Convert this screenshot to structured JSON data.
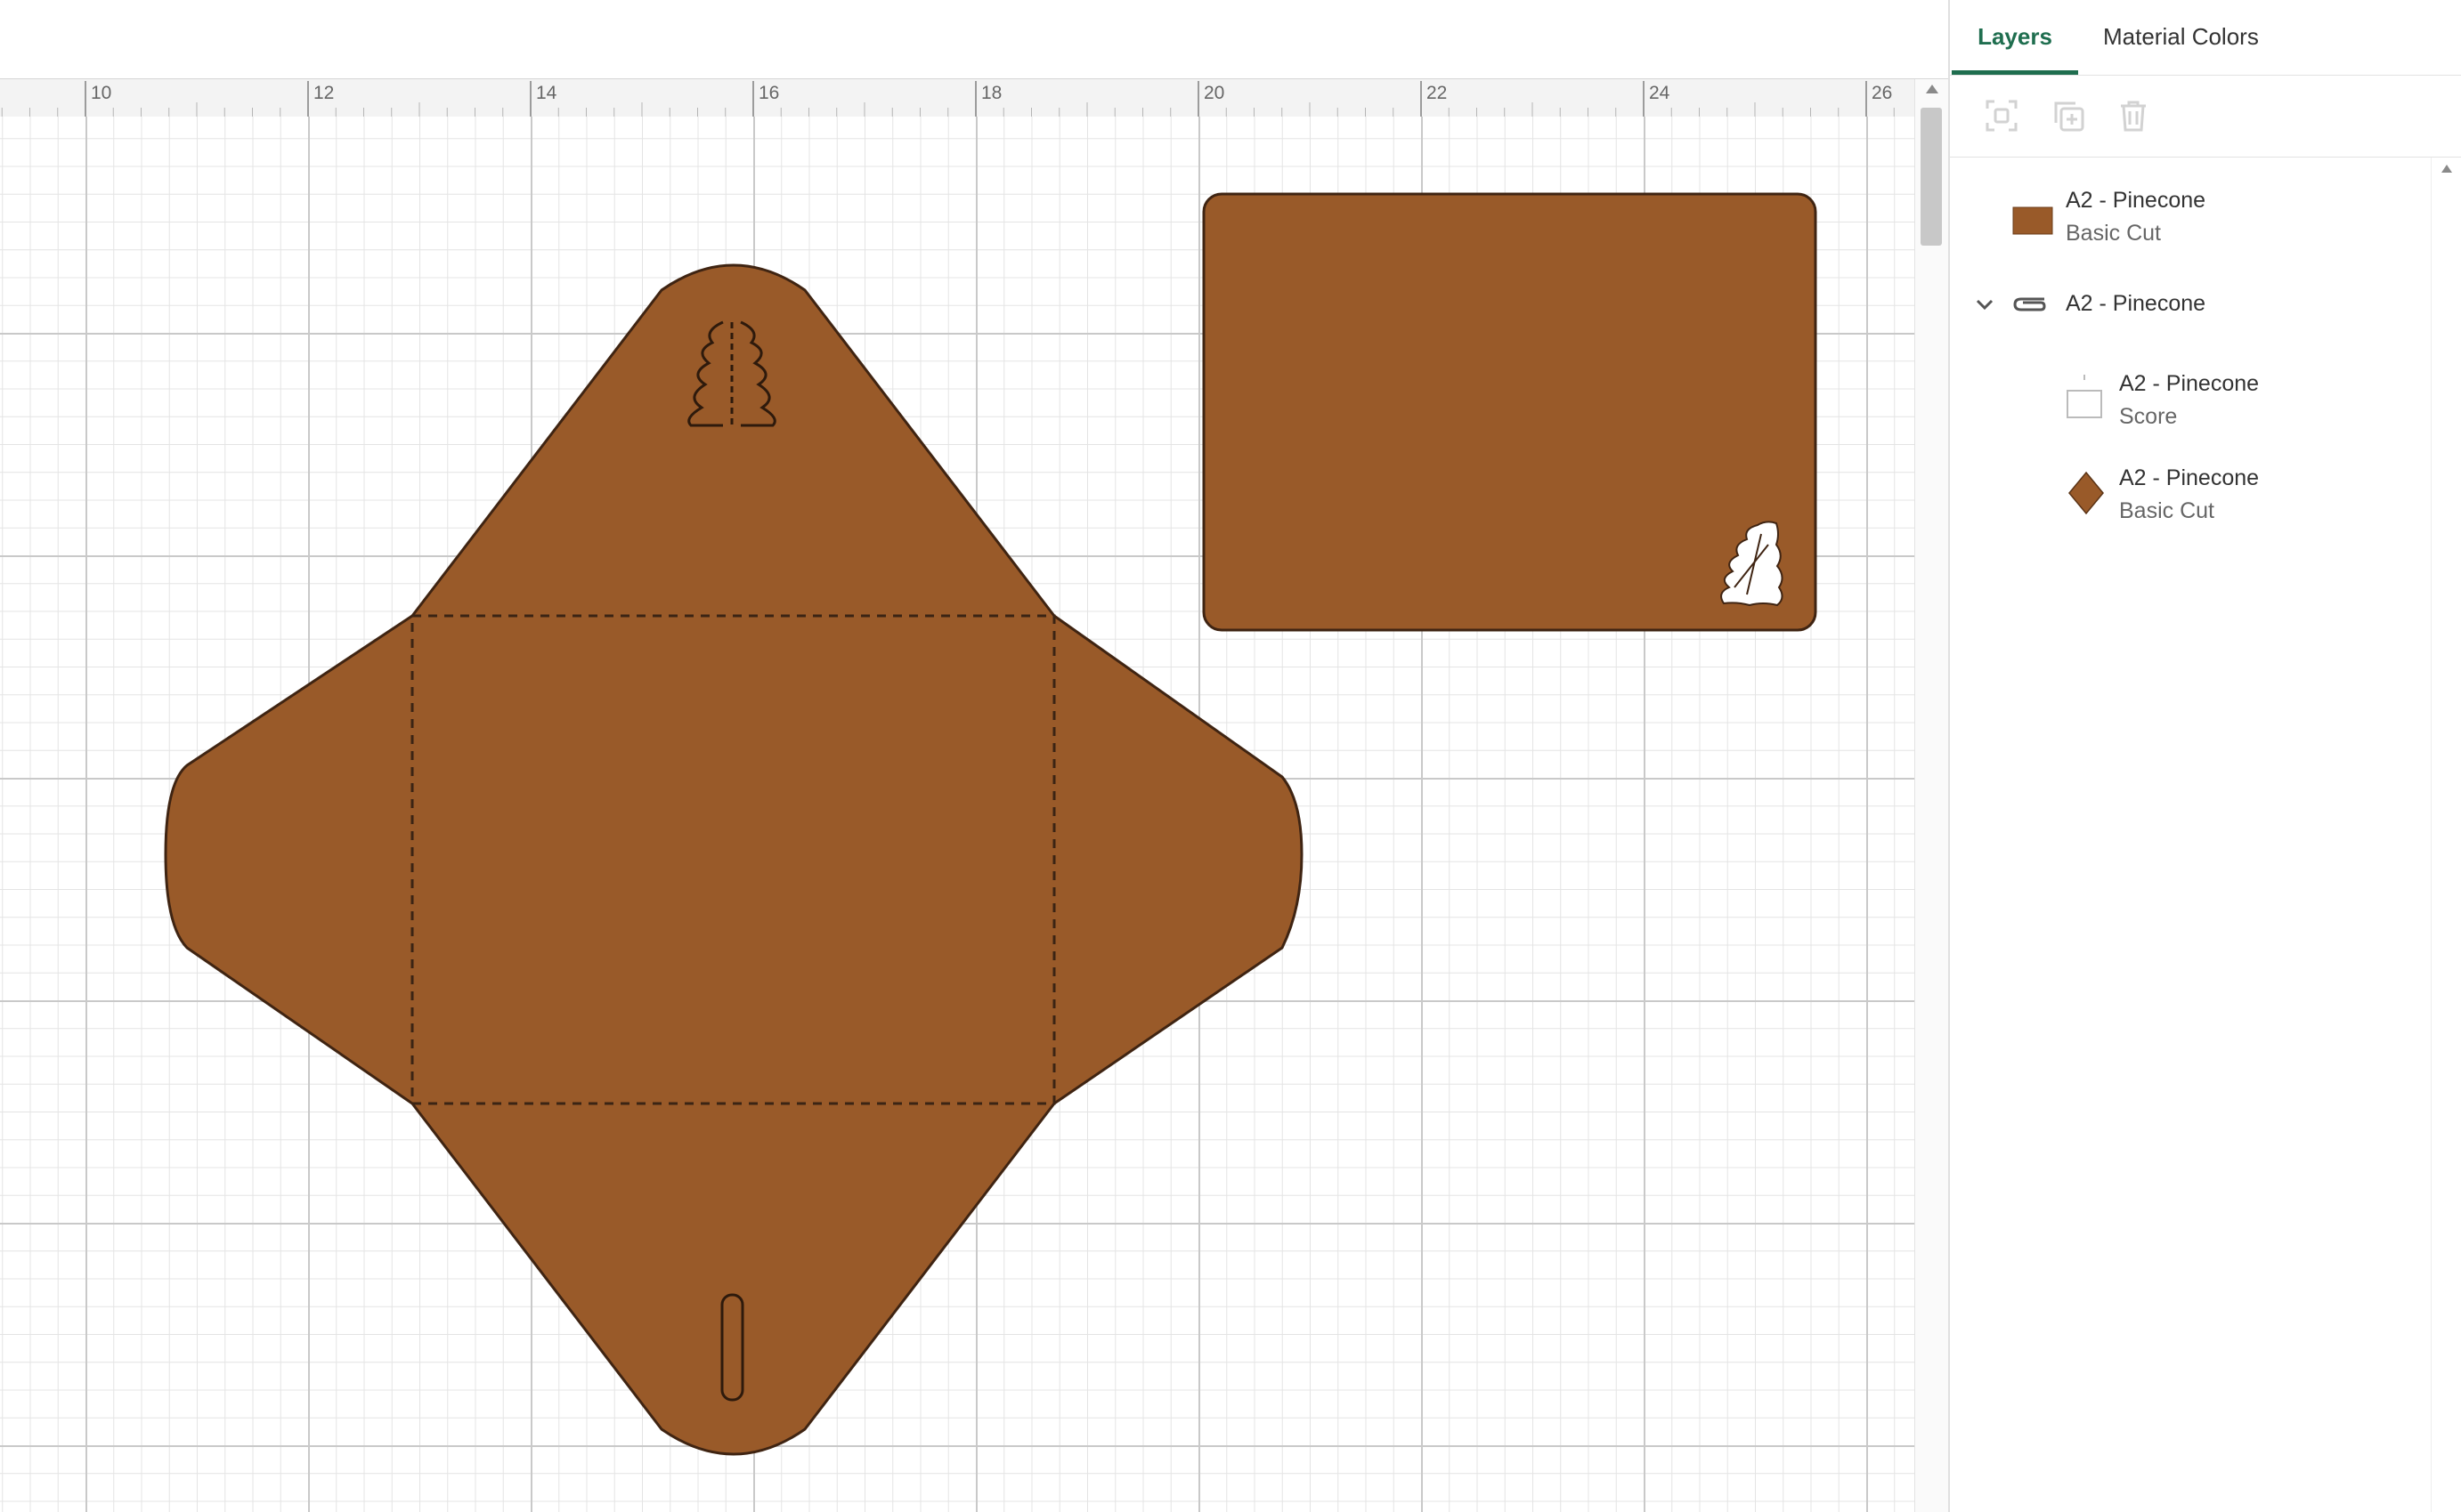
{
  "ruler": {
    "labels": [
      "10",
      "12",
      "14",
      "16",
      "18",
      "20",
      "22",
      "24",
      "26"
    ]
  },
  "colors": {
    "material": "#995a29",
    "outline": "#3f2412",
    "accent": "#1f6e4f",
    "grid_major": "#c9c9c9",
    "grid_minor": "#e4e4e4"
  },
  "panel": {
    "tabs": [
      {
        "label": "Layers",
        "active": true
      },
      {
        "label": "Material Colors",
        "active": false
      }
    ],
    "toolbar": [
      {
        "icon": "group-icon",
        "enabled": false
      },
      {
        "icon": "duplicate-icon",
        "enabled": false
      },
      {
        "icon": "trash-icon",
        "enabled": false
      }
    ],
    "layers": [
      {
        "name": "A2 - Pinecone",
        "operation": "Basic Cut",
        "thumb": "rectangle-swatch"
      },
      {
        "name": "A2 - Pinecone",
        "group": true,
        "expanded": true,
        "icon": "attach-icon"
      },
      {
        "name": "A2 - Pinecone",
        "operation": "Score",
        "thumb": "score-swatch"
      },
      {
        "name": "A2 - Pinecone",
        "operation": "Basic Cut",
        "thumb": "diamond-swatch"
      }
    ]
  }
}
